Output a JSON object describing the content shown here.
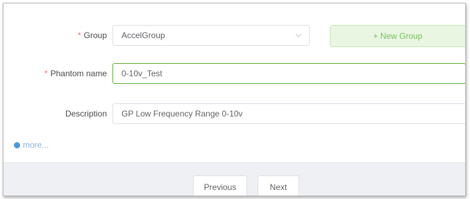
{
  "form": {
    "group": {
      "label": "Group",
      "required_mark": "*",
      "value": "AccelGroup"
    },
    "new_group_label": "+ New Group",
    "phantom_name": {
      "label": "Phantom name",
      "required_mark": "*",
      "value": "0-10v_Test"
    },
    "description": {
      "label": "Description",
      "value": "GP Low Frequency Range 0-10v"
    },
    "more_label": "more..."
  },
  "footer": {
    "previous_label": "Previous",
    "next_label": "Next"
  },
  "icons": {
    "select_arrow": "chevron-down-icon",
    "more": "info-circle-icon"
  },
  "colors": {
    "accent_green": "#79c05a",
    "required_red": "#f56c6c",
    "link_blue": "#4a9ad9"
  }
}
